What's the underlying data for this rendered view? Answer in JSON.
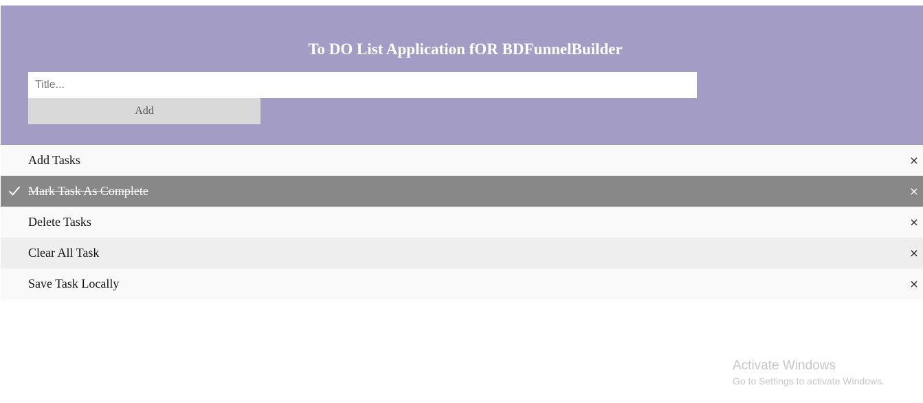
{
  "header": {
    "title": "To DO List Application fOR BDFunnelBuilder",
    "input_placeholder": "Title...",
    "add_label": "Add",
    "background_color": "#a39cc4"
  },
  "tasks": [
    {
      "label": "Add Tasks",
      "completed": false,
      "close_symbol": "×"
    },
    {
      "label": "Mark Task As Complete",
      "completed": true,
      "close_symbol": "×",
      "icon": "check-icon"
    },
    {
      "label": "Delete Tasks",
      "completed": false,
      "close_symbol": "×"
    },
    {
      "label": "Clear All Task",
      "completed": false,
      "close_symbol": "×"
    },
    {
      "label": "Save Task Locally",
      "completed": false,
      "close_symbol": "×"
    }
  ],
  "watermark": {
    "title": "Activate Windows",
    "subtitle": "Go to Settings to activate Windows."
  }
}
